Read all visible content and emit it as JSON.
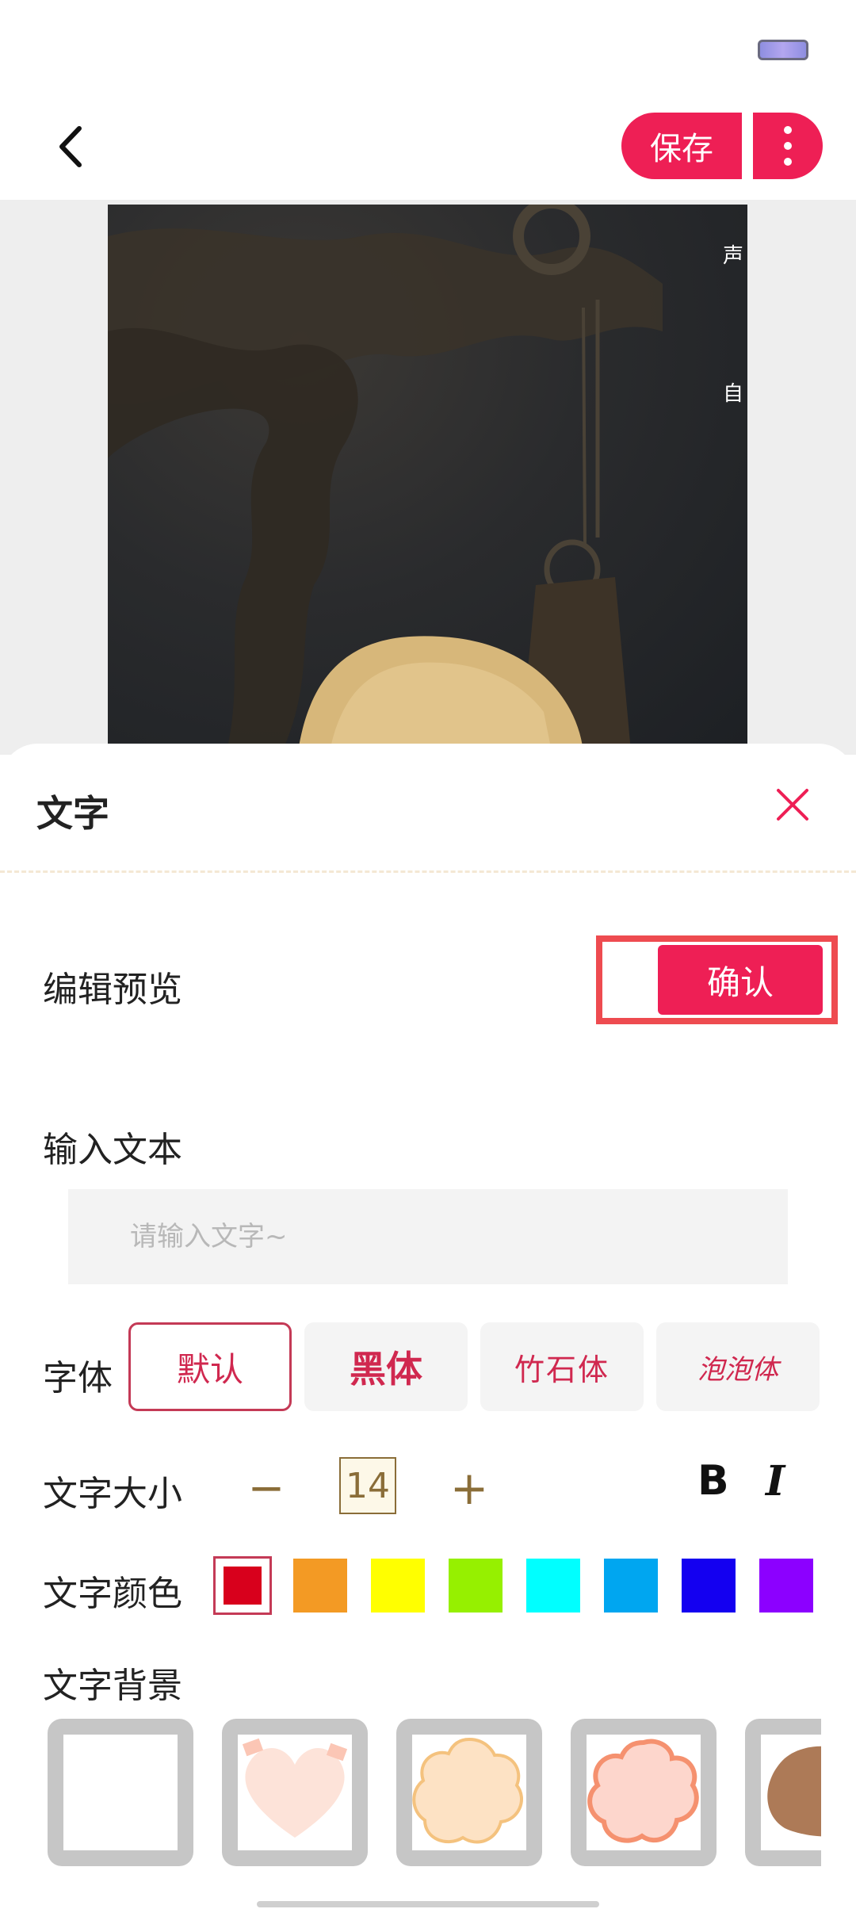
{
  "header": {
    "save_label": "保存"
  },
  "preview": {
    "side_labels": [
      "声",
      "自"
    ]
  },
  "sheet": {
    "title": "文字",
    "edit_preview_label": "编辑预览",
    "confirm_label": "确认",
    "input_text_label": "输入文本",
    "input_placeholder": "请输入文字~",
    "font_label": "字体",
    "font_options": [
      "默认",
      "黑体",
      "竹石体",
      "泡泡体"
    ],
    "selected_font": "默认",
    "size_label": "文字大小",
    "size_minus": "−",
    "size_value": "14",
    "size_plus": "+",
    "bold_label": "B",
    "italic_label": "I",
    "color_label": "文字颜色",
    "colors": [
      "#d8001c",
      "#f39a24",
      "#ffff00",
      "#96f000",
      "#00ffff",
      "#00a6f0",
      "#1400f0",
      "#8c00ff"
    ],
    "selected_color": "#d8001c",
    "background_label": "文字背景",
    "backgrounds": [
      "none-icon",
      "heart-bg-icon",
      "cream-cloud-bg-icon",
      "pink-cloud-bg-icon",
      "brown-blob-bg-icon"
    ]
  }
}
